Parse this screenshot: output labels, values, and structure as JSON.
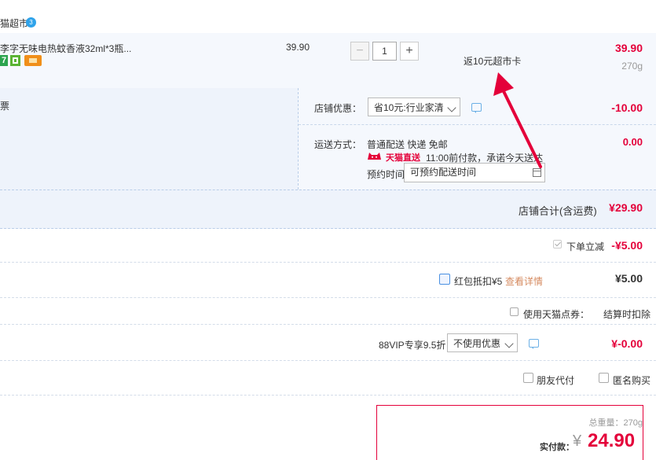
{
  "store": {
    "name": "猫超市",
    "badge": "3"
  },
  "item": {
    "title": "李字无味电热蚊香液32ml*3瓶...",
    "tag_seven": "7",
    "unit_price": "39.90",
    "quantity": "1",
    "minus_symbol": "−",
    "plus_symbol": "+",
    "rebate": "返10元超市卡",
    "subtotal": "39.90",
    "weight": "270g"
  },
  "invoice": {
    "label": "票"
  },
  "shop_coupon": {
    "label": "店铺优惠：",
    "selected": "省10元:行业家清",
    "value": "-10.00"
  },
  "shipping": {
    "label": "运送方式：",
    "option": "普通配送 快递 免邮",
    "tmall_brand": "天猫直送",
    "tmall_note": "11:00前付款，承诺今天送达",
    "appointment_label": "预约时间",
    "appointment_value": "可预约配送时间",
    "value": "0.00"
  },
  "shop_total": {
    "label": "店铺合计(含运费)",
    "value": "¥29.90"
  },
  "instant_discount": {
    "label": "下单立减",
    "value": "-¥5.00"
  },
  "red_packet": {
    "label": "红包抵扣¥5",
    "link": "查看详情",
    "value": "¥5.00"
  },
  "tmall_points": {
    "label": "使用天猫点券：",
    "note": "结算时扣除"
  },
  "vip": {
    "label": "88VIP专享9.5折",
    "selected": "不使用优惠",
    "value": "¥-0.00"
  },
  "options": {
    "friend_pay": "朋友代付",
    "anonymous": "匿名购买"
  },
  "summary": {
    "weight_label": "总重量：270g",
    "pay_label": "实付款：",
    "currency": "¥",
    "pay_value": "24.90"
  },
  "colors": {
    "accent_red": "#e4003a",
    "panel_blue": "#eef3fb",
    "border_blue": "#b9cde8",
    "link_orange": "#d58a5f"
  }
}
